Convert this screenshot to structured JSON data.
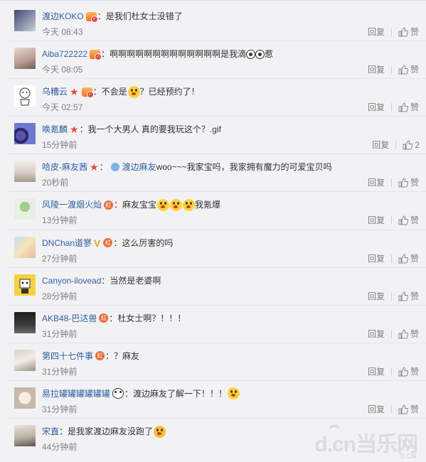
{
  "reply_label": "回复",
  "like_label": "赞",
  "comments": [
    {
      "user": "渡边KOKO",
      "content": "：是我们杜女士没错了",
      "time": "今天 08:43",
      "like_count": null
    },
    {
      "user": "Aiba722222",
      "content": "：啊啊啊啊啊啊啊啊啊啊啊啊啊是我滴",
      "content_suffix": "惹",
      "time": "今天 08:05",
      "like_count": null
    },
    {
      "user": "乌糟云",
      "content_pre": "：不会是",
      "content": "？已经预约了！",
      "time": "今天 02:57",
      "like_count": null
    },
    {
      "user": "唤氪麟",
      "content": "：我一个大男人 真的要我玩这个？.gif",
      "time": "15分钟前",
      "like_count": "2"
    },
    {
      "user": "哈皮-麻友茜",
      "content": "：",
      "reply_to": "渡边麻友",
      "content_post": " woo~~~我家宝吗，我家拥有魔力的可爱宝贝吗",
      "time": "20秒前",
      "like_count": null
    },
    {
      "user": "风陵一渡烟火灿",
      "content": "：麻友宝宝",
      "content_suffix": "我氪爆",
      "time": "13分钟前",
      "like_count": null
    },
    {
      "user": "DNChan道寥",
      "content": "：这么厉害的吗",
      "time": "27分钟前",
      "like_count": null
    },
    {
      "user": "Canyon-ilovead",
      "content": "：当然是老婆啊",
      "time": "28分钟前",
      "like_count": null
    },
    {
      "user": "AKB48-巴达兽",
      "content": "：杜女士啊？！！！",
      "time": "31分钟前",
      "like_count": null
    },
    {
      "user": "第四十七件事",
      "content": "：？麻友",
      "time": "31分钟前",
      "like_count": null
    },
    {
      "user": "易拉罐罐罐罐罐罐",
      "content": "：渡边麻友了解一下！！！",
      "time": "31分钟前",
      "like_count": null
    },
    {
      "user": "宋直",
      "content": "：是我家渡边麻友没跑了",
      "time": "44分钟前",
      "like_count": null
    }
  ],
  "badge_hong": "紅",
  "watermark": "d.cn当乐网",
  "watermark_sub": "D.CN",
  "colors": {
    "username": "#2f5fa1",
    "meta": "#808080",
    "badge_red": "#e8483c",
    "bg": "#f2f2f5"
  }
}
